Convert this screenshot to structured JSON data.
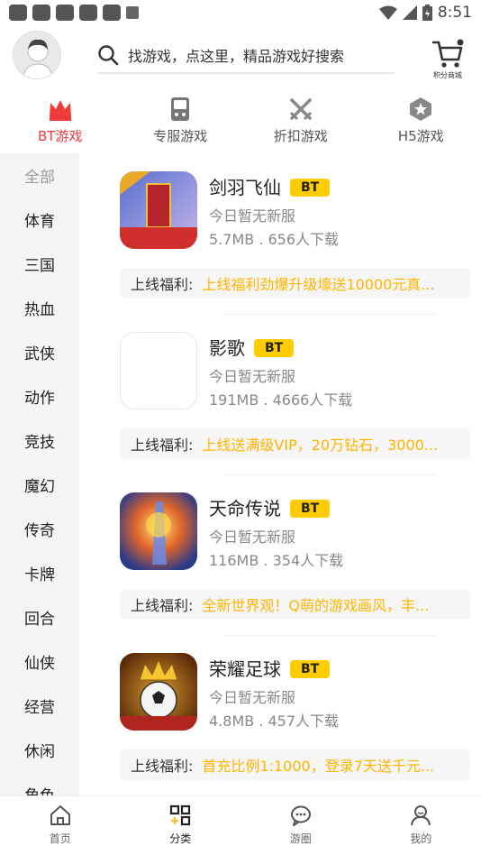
{
  "status_bar": {
    "time": "8:51"
  },
  "header": {
    "search_placeholder": "找游戏，点这里，精品游戏好搜索",
    "shop_label": "积分商城"
  },
  "category_tabs": [
    {
      "label": "BT游戏",
      "icon": "crown-icon",
      "active": true
    },
    {
      "label": "专服游戏",
      "icon": "gamepad-icon",
      "active": false
    },
    {
      "label": "折扣游戏",
      "icon": "swords-icon",
      "active": false
    },
    {
      "label": "H5游戏",
      "icon": "hexagon-star-icon",
      "active": false
    }
  ],
  "sidebar": {
    "items": [
      "全部",
      "体育",
      "三国",
      "热血",
      "武侠",
      "动作",
      "竞技",
      "魔幻",
      "传奇",
      "卡牌",
      "回合",
      "仙侠",
      "经营",
      "休闲",
      "角色"
    ],
    "active_index": 0
  },
  "games": [
    {
      "name": "剑羽飞仙",
      "badge": "BT",
      "status": "今日暂无新服",
      "meta": "5.7MB . 656人下载",
      "welfare_label": "上线福利:",
      "welfare_text": "上线福利劲爆升级壕送10000元真..."
    },
    {
      "name": "影歌",
      "badge": "BT",
      "status": "今日暂无新服",
      "meta": "191MB . 4666人下载",
      "welfare_label": "上线福利:",
      "welfare_text": "上线送满级VIP，20万钻石，3000..."
    },
    {
      "name": "天命传说",
      "badge": "BT",
      "status": "今日暂无新服",
      "meta": "116MB . 354人下载",
      "welfare_label": "上线福利:",
      "welfare_text": "全新世界观！Q萌的游戏画风，丰..."
    },
    {
      "name": "荣耀足球",
      "badge": "BT",
      "status": "今日暂无新服",
      "meta": "4.8MB . 457人下载",
      "welfare_label": "上线福利:",
      "welfare_text": "首充比例1:1000，登录7天送千元..."
    }
  ],
  "bottom_nav": [
    {
      "label": "首页",
      "icon": "home-icon",
      "active": false
    },
    {
      "label": "分类",
      "icon": "grid-icon",
      "active": true
    },
    {
      "label": "游圈",
      "icon": "chat-icon",
      "active": false
    },
    {
      "label": "我的",
      "icon": "user-icon",
      "active": false
    }
  ],
  "colors": {
    "accent_red": "#f23a3a",
    "badge_yellow": "#ffcc00",
    "welfare_text": "#ffb400"
  }
}
